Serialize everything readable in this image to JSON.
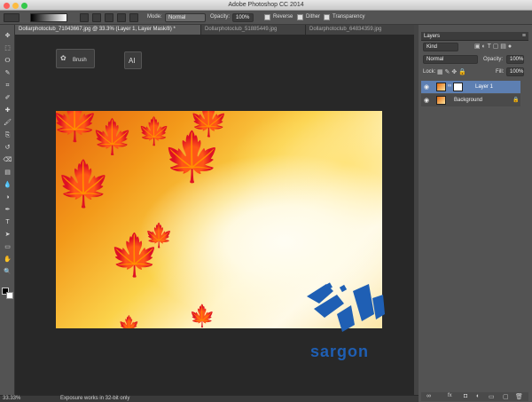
{
  "app_title": "Adobe Photoshop CC 2014",
  "options": {
    "mode_label": "Mode:",
    "mode_value": "Normal",
    "opacity_label": "Opacity:",
    "opacity_value": "100%",
    "reverse": "Reverse",
    "dither": "Dither",
    "transparency": "Transparency"
  },
  "tabs": [
    {
      "label": "Dollarphotoclub_71043667.jpg @ 33.3% (Layer 1, Layer Mask/8) *"
    },
    {
      "label": "Dollarphotoclub_51885449.jpg"
    },
    {
      "label": "Dollarphotoclub_64834359.jpg"
    }
  ],
  "tips": {
    "brush": "Brush",
    "ai": "AI"
  },
  "layers": {
    "title": "Layers",
    "kind": "Kind",
    "blend": "Normal",
    "opacity_label": "Opacity:",
    "opacity": "100%",
    "lock_label": "Lock:",
    "fill_label": "Fill:",
    "fill": "100%",
    "items": [
      {
        "name": "Layer 1"
      },
      {
        "name": "Background"
      }
    ]
  },
  "status": {
    "zoom": "33.33%",
    "message": "Exposure works in 32-bit only"
  },
  "watermark": {
    "text": "sargon",
    "color": "#1f5fb4"
  },
  "icons": [
    "move-icon",
    "marquee-icon",
    "lasso-icon",
    "quick-select-icon",
    "crop-icon",
    "eyedropper-icon",
    "healing-icon",
    "brush-icon",
    "clone-stamp-icon",
    "history-brush-icon",
    "eraser-icon",
    "gradient-icon",
    "blur-icon",
    "dodge-icon",
    "pen-icon",
    "type-icon",
    "path-select-icon",
    "shape-icon",
    "hand-icon",
    "zoom-icon"
  ]
}
